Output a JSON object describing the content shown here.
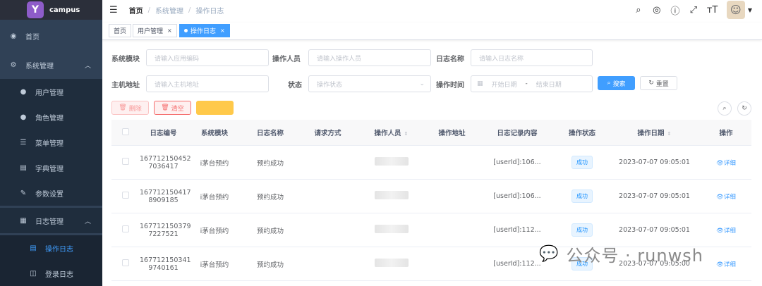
{
  "app": {
    "name": "campus",
    "logo_letter": "Y"
  },
  "sidebar": {
    "items": [
      {
        "label": "首页",
        "icon": "dashboard-icon",
        "glyph": "◉"
      },
      {
        "label": "系统管理",
        "icon": "gear-icon",
        "glyph": "⚙",
        "expanded": true
      },
      {
        "label": "用户管理",
        "icon": "user-icon",
        "glyph": "👤"
      },
      {
        "label": "角色管理",
        "icon": "peoples-icon",
        "glyph": "👥"
      },
      {
        "label": "菜单管理",
        "icon": "tree-table-icon",
        "glyph": "☰"
      },
      {
        "label": "字典管理",
        "icon": "dict-icon",
        "glyph": "▤"
      },
      {
        "label": "参数设置",
        "icon": "edit-icon",
        "glyph": "✎"
      },
      {
        "label": "日志管理",
        "icon": "log-icon",
        "glyph": "▦",
        "expanded": true
      },
      {
        "label": "操作日志",
        "icon": "form-icon",
        "glyph": "▤",
        "active": true
      },
      {
        "label": "登录日志",
        "icon": "logininfor-icon",
        "glyph": "◫"
      }
    ]
  },
  "breadcrumb": {
    "home": "首页",
    "sep": "/",
    "level1": "系统管理",
    "level2": "操作日志"
  },
  "tags": [
    {
      "label": "首页"
    },
    {
      "label": "用户管理",
      "close": "×"
    },
    {
      "label": "操作日志",
      "close": "×",
      "active": true
    }
  ],
  "toolbar_icons": [
    "search-icon",
    "github-icon",
    "question-icon",
    "fullscreen-icon",
    "font-size-icon"
  ],
  "search": {
    "system_module": {
      "label": "系统模块",
      "placeholder": "请输入应用编码"
    },
    "operator": {
      "label": "操作人员",
      "placeholder": "请输入操作人员"
    },
    "log_name": {
      "label": "日志名称",
      "placeholder": "请输入日志名称"
    },
    "host": {
      "label": "主机地址",
      "placeholder": "请输入主机地址"
    },
    "status": {
      "label": "状态",
      "placeholder": "操作状态"
    },
    "time": {
      "label": "操作时间",
      "start": "开始日期",
      "sep": "-",
      "end": "结束日期"
    },
    "search_button": "搜索",
    "reset_button": "重置"
  },
  "actions": {
    "delete": "删除",
    "clear": "清空",
    "export": ""
  },
  "table": {
    "headers": [
      "",
      "日志编号",
      "系统模块",
      "日志名称",
      "请求方式",
      "操作人员",
      "操作地址",
      "日志记录内容",
      "操作状态",
      "操作日期",
      "操作"
    ],
    "rows": [
      {
        "id1": "167712150452",
        "id2": "7036417",
        "module": "i茅台预约",
        "name": "预约成功",
        "method": "",
        "content": "[userId]:106...",
        "status": "成功",
        "date": "2023-07-07 09:05:01",
        "action": "详细"
      },
      {
        "id1": "167712150417",
        "id2": "8909185",
        "module": "i茅台预约",
        "name": "预约成功",
        "method": "",
        "content": "[userId]:106...",
        "status": "成功",
        "date": "2023-07-07 09:05:01",
        "action": "详细"
      },
      {
        "id1": "167712150379",
        "id2": "7227521",
        "module": "i茅台预约",
        "name": "预约成功",
        "method": "",
        "content": "[userId]:112...",
        "status": "成功",
        "date": "2023-07-07 09:05:01",
        "action": "详细"
      },
      {
        "id1": "167712150341",
        "id2": "9740161",
        "module": "i茅台预约",
        "name": "预约成功",
        "method": "",
        "content": "[userId]:112...",
        "status": "成功",
        "date": "2023-07-07 09:05:00",
        "action": "详细"
      }
    ]
  },
  "watermark": "公众号 · runwsh",
  "colors": {
    "sidebar_bg": "#304156",
    "primary": "#409eff",
    "danger": "#f56c6c",
    "warning": "#ffc94a"
  }
}
